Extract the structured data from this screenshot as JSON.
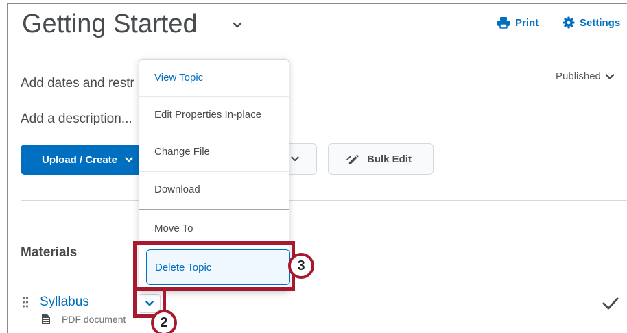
{
  "header": {
    "title": "Getting Started",
    "print_label": "Print",
    "settings_label": "Settings"
  },
  "module": {
    "dates_text": "Add dates and restr",
    "description_text": "Add a description...",
    "status_label": "Published"
  },
  "toolbar": {
    "upload_label": "Upload / Create",
    "bulk_edit_label": "Bulk Edit"
  },
  "menu": {
    "items": [
      {
        "label": "View Topic"
      },
      {
        "label": "Edit Properties In-place"
      },
      {
        "label": "Change File"
      },
      {
        "label": "Download"
      },
      {
        "label": "Move To"
      },
      {
        "label": "Delete Topic"
      }
    ]
  },
  "section": {
    "title": "Materials"
  },
  "topic": {
    "name": "Syllabus",
    "type": "PDF document"
  },
  "callouts": {
    "step_2": "2",
    "step_3": "3"
  },
  "colors": {
    "accent": "#006fbf",
    "callout": "#a6192e",
    "text": "#494c4e"
  }
}
